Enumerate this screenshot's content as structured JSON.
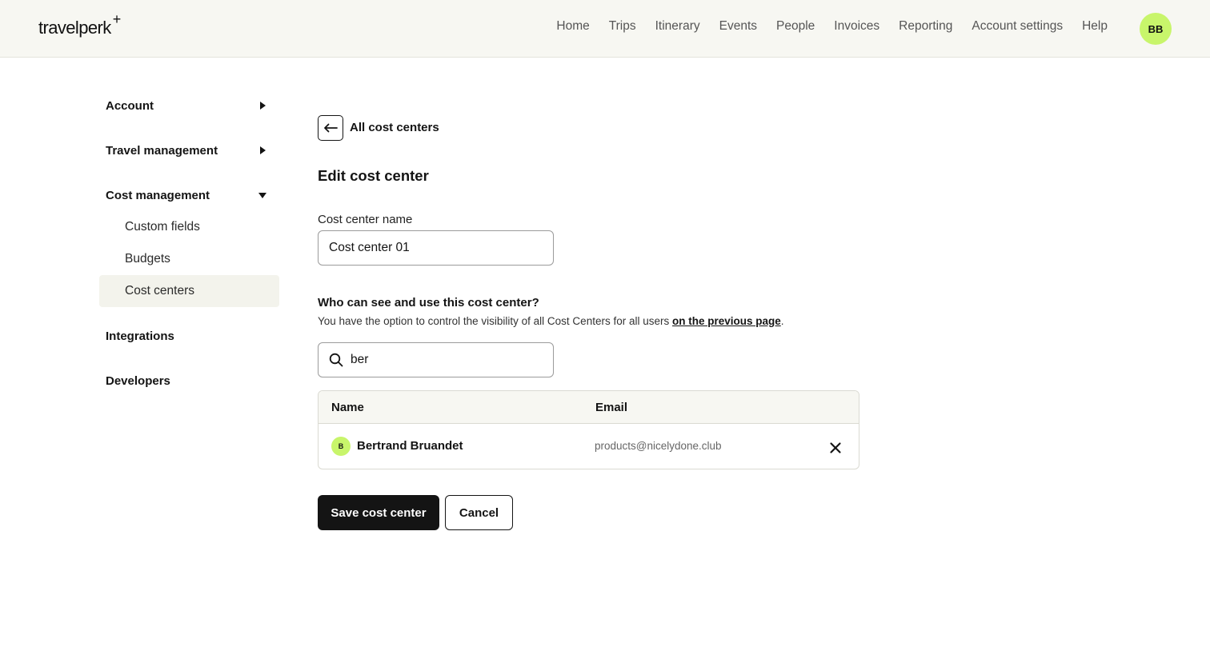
{
  "header": {
    "logo": "travelperk",
    "logo_plus": "+",
    "nav": [
      "Home",
      "Trips",
      "Itinerary",
      "Events",
      "People",
      "Invoices",
      "Reporting",
      "Account settings",
      "Help"
    ],
    "avatar_initials": "BB"
  },
  "sidebar": {
    "account": "Account",
    "travel_management": "Travel management",
    "cost_management": "Cost management",
    "sub_items": [
      "Custom fields",
      "Budgets",
      "Cost centers"
    ],
    "integrations": "Integrations",
    "developers": "Developers"
  },
  "main": {
    "back_label": "All cost centers",
    "title": "Edit cost center",
    "name_label": "Cost center name",
    "name_value": "Cost center 01",
    "visibility_heading": "Who can see and use this cost center?",
    "visibility_desc": "You have the option to control the visibility of all Cost Centers for all users ",
    "visibility_link": "on the previous page",
    "visibility_desc_end": ".",
    "search_value": "ber",
    "table": {
      "col_name": "Name",
      "col_email": "Email",
      "rows": [
        {
          "initial": "B",
          "name": "Bertrand Bruandet",
          "email": "products@nicelydone.club"
        }
      ]
    },
    "save_label": "Save cost center",
    "cancel_label": "Cancel"
  },
  "colors": {
    "accent": "#c8f56b",
    "header_bg": "#f7f7f2",
    "primary_button": "#141414"
  }
}
